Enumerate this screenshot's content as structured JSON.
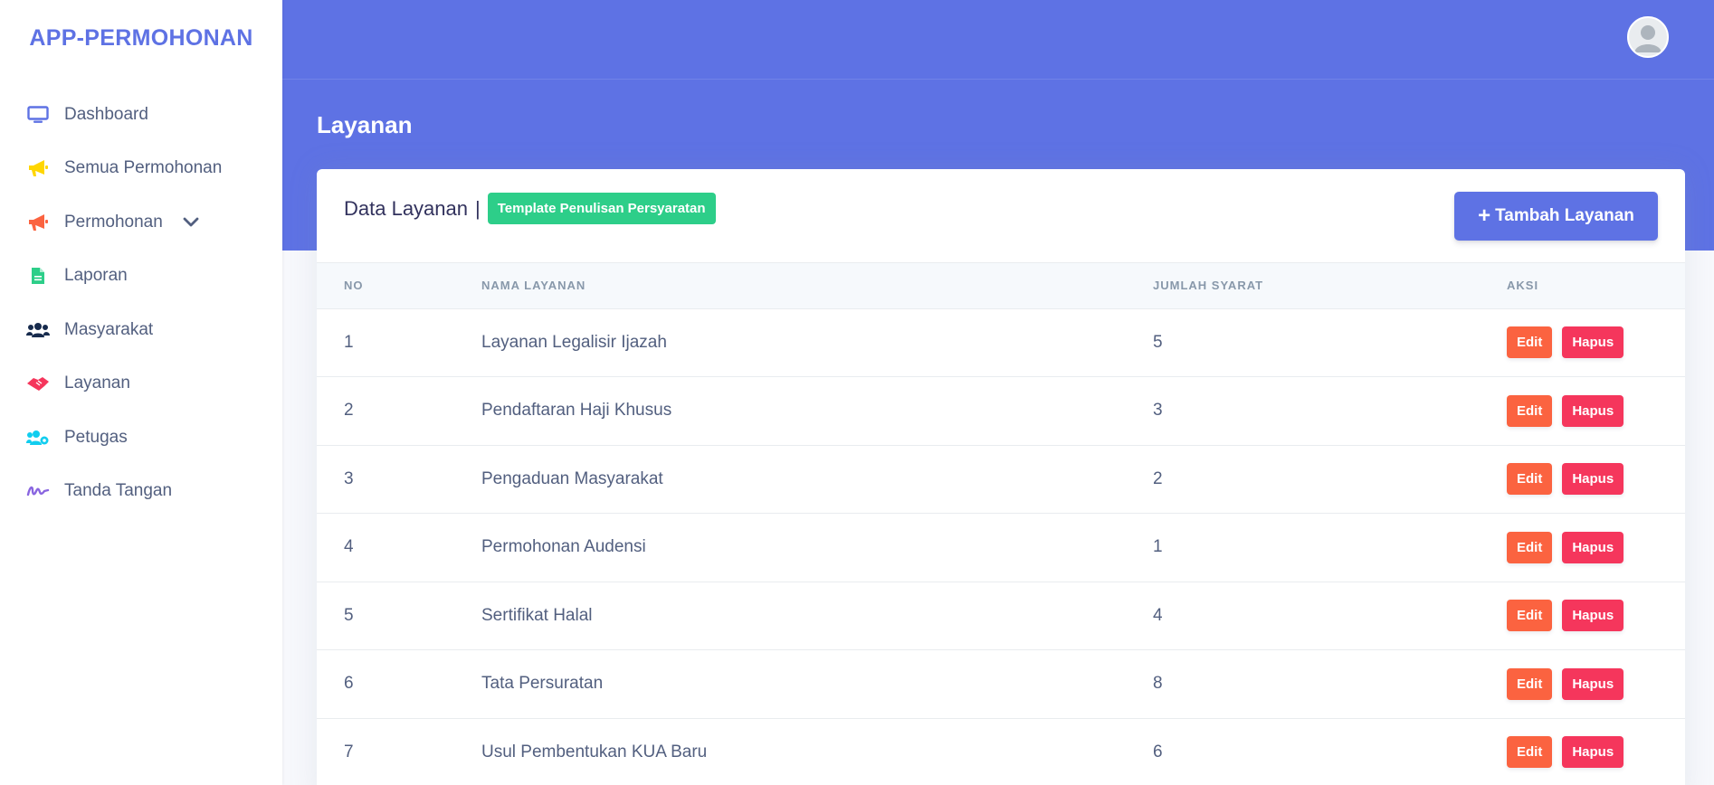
{
  "brand": "APP-PERMOHONAN",
  "sidebar": {
    "items": [
      {
        "label": "Dashboard",
        "icon": "monitor-icon",
        "color": "#5e72e4"
      },
      {
        "label": "Semua Permohonan",
        "icon": "megaphone-icon",
        "color": "#ffd600"
      },
      {
        "label": "Permohonan",
        "icon": "megaphone-icon",
        "color": "#fb6340"
      },
      {
        "label": "Laporan",
        "icon": "document-icon",
        "color": "#2dce89"
      },
      {
        "label": "Masyarakat",
        "icon": "users-icon",
        "color": "#172b4d"
      },
      {
        "label": "Layanan",
        "icon": "handshake-icon",
        "color": "#f5365c"
      },
      {
        "label": "Petugas",
        "icon": "users-cog-icon",
        "color": "#11cdef"
      },
      {
        "label": "Tanda Tangan",
        "icon": "signature-icon",
        "color": "#8965e0"
      }
    ]
  },
  "header": {
    "page_title": "Layanan"
  },
  "card": {
    "title": "Data Layanan",
    "separator": "|",
    "template_label": "Template Penulisan Persyaratan",
    "add_button": "Tambah Layanan"
  },
  "table": {
    "headers": [
      "NO",
      "NAMA LAYANAN",
      "JUMLAH SYARAT",
      "AKSI"
    ],
    "rows": [
      {
        "no": "1",
        "name": "Layanan Legalisir Ijazah",
        "count": "5"
      },
      {
        "no": "2",
        "name": "Pendaftaran Haji Khusus",
        "count": "3"
      },
      {
        "no": "3",
        "name": "Pengaduan Masyarakat",
        "count": "2"
      },
      {
        "no": "4",
        "name": "Permohonan Audensi",
        "count": "1"
      },
      {
        "no": "5",
        "name": "Sertifikat Halal",
        "count": "4"
      },
      {
        "no": "6",
        "name": "Tata Persuratan",
        "count": "8"
      },
      {
        "no": "7",
        "name": "Usul Pembentukan KUA Baru",
        "count": "6"
      }
    ],
    "edit_label": "Edit",
    "delete_label": "Hapus"
  },
  "colors": {
    "primary": "#5e72e4",
    "success": "#2dce89",
    "warning": "#fb6340",
    "danger": "#f5365c"
  }
}
